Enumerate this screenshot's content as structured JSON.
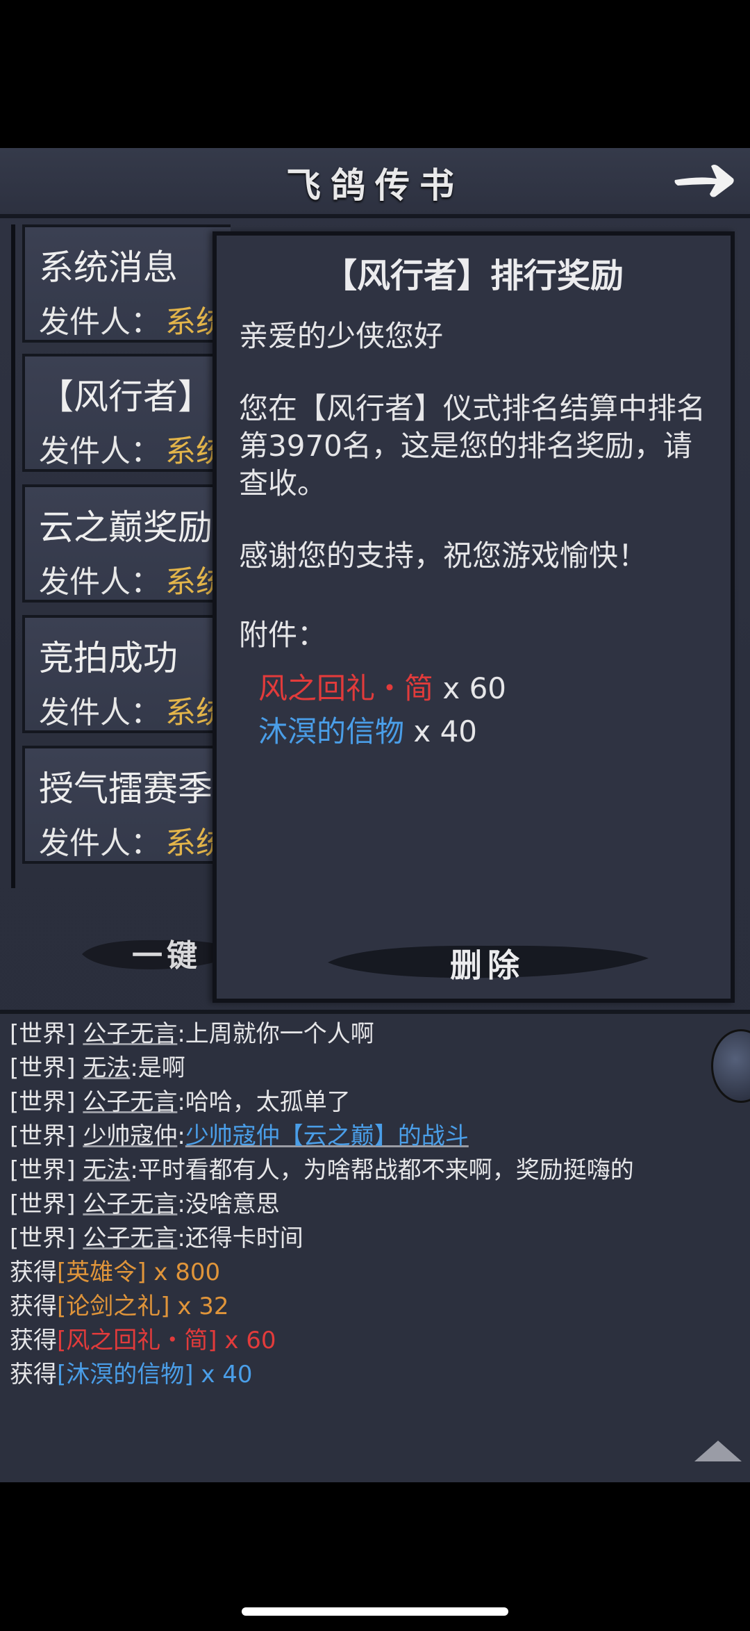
{
  "header": {
    "title": "飞鸽传书"
  },
  "mail_list": {
    "sender_label": "发件人：",
    "items": [
      {
        "title": "系统消息",
        "sender": "系统"
      },
      {
        "title": "【风行者】排",
        "sender": "系统"
      },
      {
        "title": "云之巅奖励",
        "sender": "系统"
      },
      {
        "title": "竞拍成功",
        "sender": "系统"
      },
      {
        "title": "授气擂赛季",
        "sender": "系统"
      }
    ],
    "one_key_label": "一键"
  },
  "detail": {
    "title": "【风行者】排行奖励",
    "greeting": "亲爱的少侠您好",
    "body": "您在【风行者】仪式排名结算中排名第3970名，这是您的排名奖励，请查收。",
    "thanks": "感谢您的支持，祝您游戏愉快！",
    "attachment_label": "附件：",
    "attachments": [
      {
        "name": "风之回礼・简",
        "qty": "x 60",
        "color": "#e23b3b"
      },
      {
        "name": "沐溟的信物",
        "qty": "x 40",
        "color": "#4a9ee8"
      }
    ],
    "delete_label": "删除"
  },
  "chat": {
    "lines": [
      {
        "channel": "[世界]",
        "user": "公子无言",
        "text": ":上周就你一个人啊"
      },
      {
        "channel": "[世界]",
        "user": "无法",
        "text": ":是啊"
      },
      {
        "channel": "[世界]",
        "user": "公子无言",
        "text": ":哈哈，太孤单了"
      },
      {
        "channel": "[世界]",
        "user": "少帅寇仲",
        "text": ":",
        "link": "少帅寇仲【云之巅】的战斗"
      },
      {
        "channel": "[世界]",
        "user": "无法",
        "text": ":平时看都有人，为啥帮战都不来啊，奖励挺嗨的"
      },
      {
        "channel": "[世界]",
        "user": "公子无言",
        "text": ":没啥意思"
      },
      {
        "channel": "[世界]",
        "user": "公子无言",
        "text": ":还得卡时间"
      }
    ],
    "rewards": [
      {
        "prefix": "获得",
        "item": "[英雄令]",
        "qty": " x 800",
        "color": "#e0953a"
      },
      {
        "prefix": "获得",
        "item": "[论剑之礼]",
        "qty": " x 32",
        "color": "#e0953a"
      },
      {
        "prefix": "获得",
        "item": "[风之回礼・简]",
        "qty": " x 60",
        "color": "#e23b3b"
      },
      {
        "prefix": "获得",
        "item": "[沐溟的信物]",
        "qty": " x 40",
        "color": "#4a9ee8"
      }
    ],
    "link_color": "#4a9ee8"
  }
}
